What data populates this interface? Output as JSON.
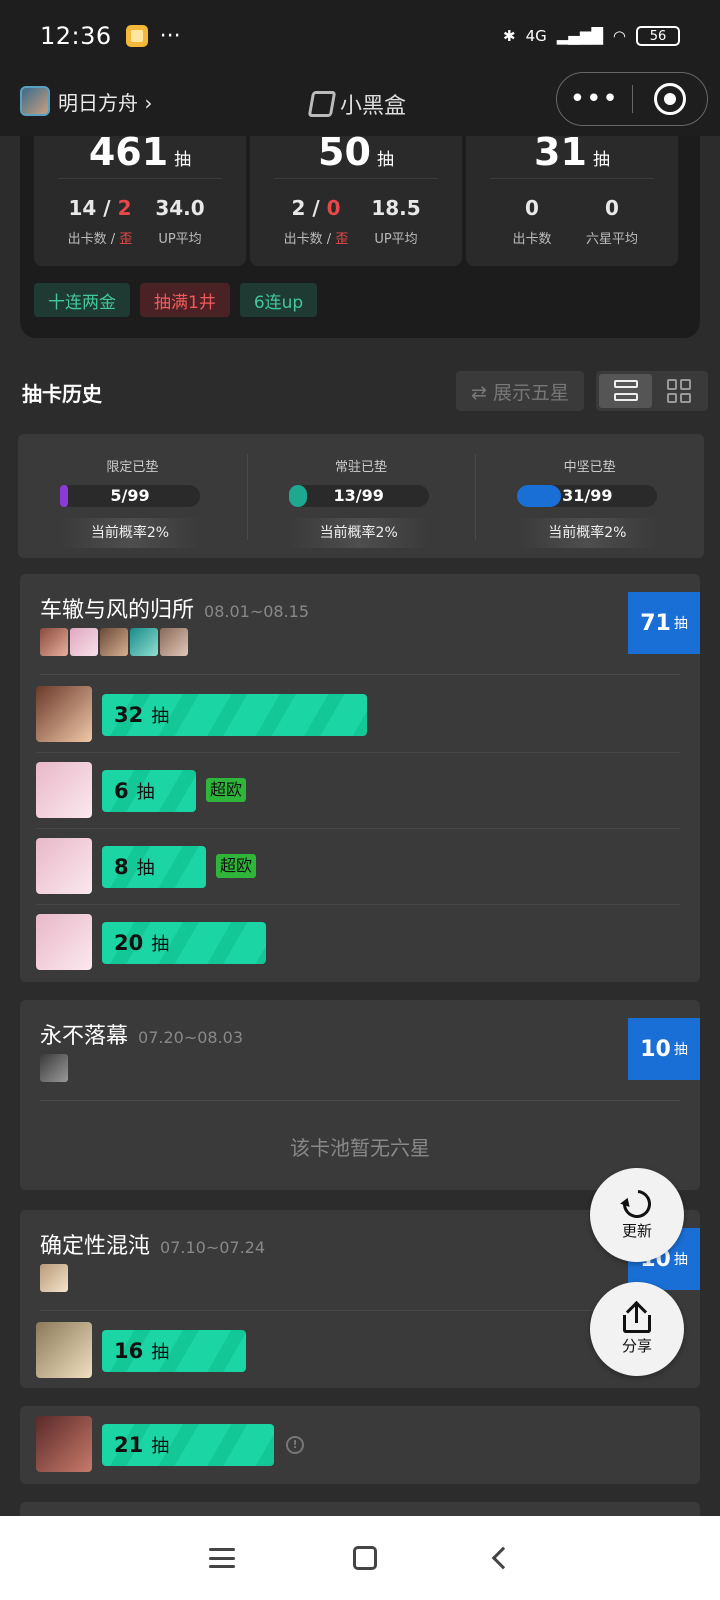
{
  "status_bar": {
    "time": "12:36",
    "dots": "···",
    "network": "4G",
    "battery": "56"
  },
  "header": {
    "game": "明日方舟 ›",
    "app_name": "小黑盒",
    "more": "•••"
  },
  "summary": {
    "boxes": [
      {
        "total": "461",
        "unit": "抽",
        "a_val": "14",
        "a_sep": " / ",
        "a_red": "2",
        "a_label": "出卡数 / ",
        "a_label_red": "歪",
        "b_val": "34.0",
        "b_label": "UP平均"
      },
      {
        "total": "50",
        "unit": "抽",
        "a_val": "2",
        "a_sep": " / ",
        "a_red": "0",
        "a_label": "出卡数 / ",
        "a_label_red": "歪",
        "b_val": "18.5",
        "b_label": "UP平均"
      },
      {
        "total": "31",
        "unit": "抽",
        "a_val": "0",
        "a_label": "出卡数",
        "b_val": "0",
        "b_label": "六星平均"
      }
    ],
    "tags": [
      {
        "text": "十连两金"
      },
      {
        "text": "抽满1井"
      },
      {
        "text": "6连up"
      }
    ]
  },
  "history": {
    "title": "抽卡历史",
    "toggle_label": "⇄ 展示五星"
  },
  "pity": [
    {
      "label": "限定已垫",
      "value": "5/99",
      "fraction": 0.0505,
      "color": "#8a3ad6",
      "rate": "当前概率2%"
    },
    {
      "label": "常驻已垫",
      "value": "13/99",
      "fraction": 0.1313,
      "color": "#1fa890",
      "rate": "当前概率2%"
    },
    {
      "label": "中坚已垫",
      "value": "31/99",
      "fraction": 0.3131,
      "color": "#1a6fd6",
      "rate": "当前概率2%"
    }
  ],
  "pools": [
    {
      "name": "车辙与风的归所",
      "date": "08.01~08.15",
      "total": "71",
      "unit": "抽",
      "pulls": [
        {
          "count": "32",
          "unit": "抽",
          "badge": ""
        },
        {
          "count": "6",
          "unit": "抽",
          "badge": "超欧"
        },
        {
          "count": "8",
          "unit": "抽",
          "badge": "超欧"
        },
        {
          "count": "20",
          "unit": "抽",
          "badge": ""
        }
      ]
    },
    {
      "name": "永不落幕",
      "date": "07.20~08.03",
      "total": "10",
      "unit": "抽",
      "empty": "该卡池暂无六星"
    },
    {
      "name": "确定性混沌",
      "date": "07.10~07.24",
      "total": "10",
      "unit": "抽",
      "pulls": [
        {
          "count": "16",
          "unit": "抽",
          "badge": ""
        }
      ]
    },
    {
      "pulls": [
        {
          "count": "21",
          "unit": "抽",
          "badge": ""
        }
      ]
    }
  ],
  "fabs": {
    "refresh": "更新",
    "share": "分享"
  }
}
